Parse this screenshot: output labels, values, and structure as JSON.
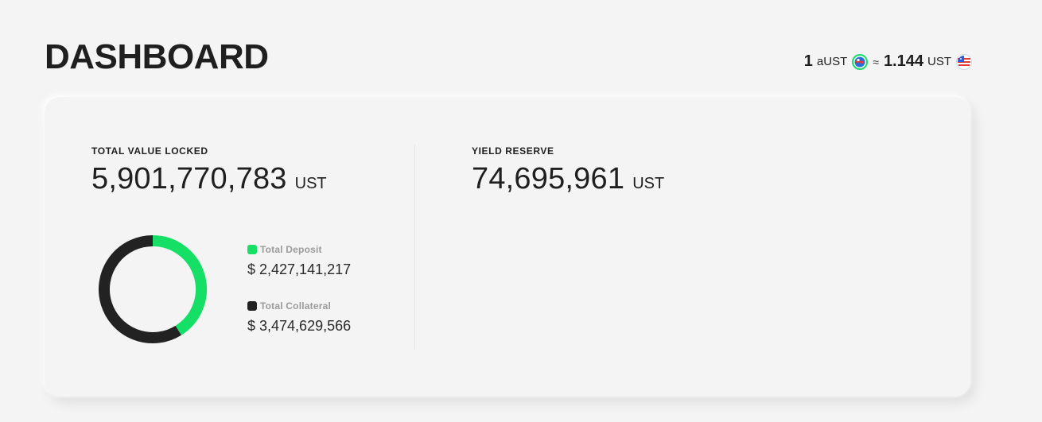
{
  "header": {
    "title": "DASHBOARD"
  },
  "rate": {
    "left_amount": "1",
    "left_unit": "aUST",
    "approx_symbol": "≈",
    "right_amount": "1.144",
    "right_unit": "UST",
    "left_icon": "aust-token-icon",
    "right_icon": "ust-token-icon"
  },
  "tvl": {
    "label": "TOTAL VALUE LOCKED",
    "value": "5,901,770,783",
    "unit": "UST"
  },
  "yield_reserve": {
    "label": "YIELD RESERVE",
    "value": "74,695,961",
    "unit": "UST"
  },
  "breakdown": {
    "deposit": {
      "label": "Total Deposit",
      "value": "$ 2,427,141,217",
      "amount": 2427141217,
      "color": "#15e065"
    },
    "collateral": {
      "label": "Total Collateral",
      "value": "$ 3,474,629,566",
      "amount": 3474629566,
      "color": "#222222"
    }
  },
  "chart_data": {
    "type": "pie",
    "categories": [
      "Total Deposit",
      "Total Collateral"
    ],
    "values": [
      2427141217,
      3474629566
    ],
    "colors": [
      "#15e065",
      "#222222"
    ],
    "title": ""
  }
}
